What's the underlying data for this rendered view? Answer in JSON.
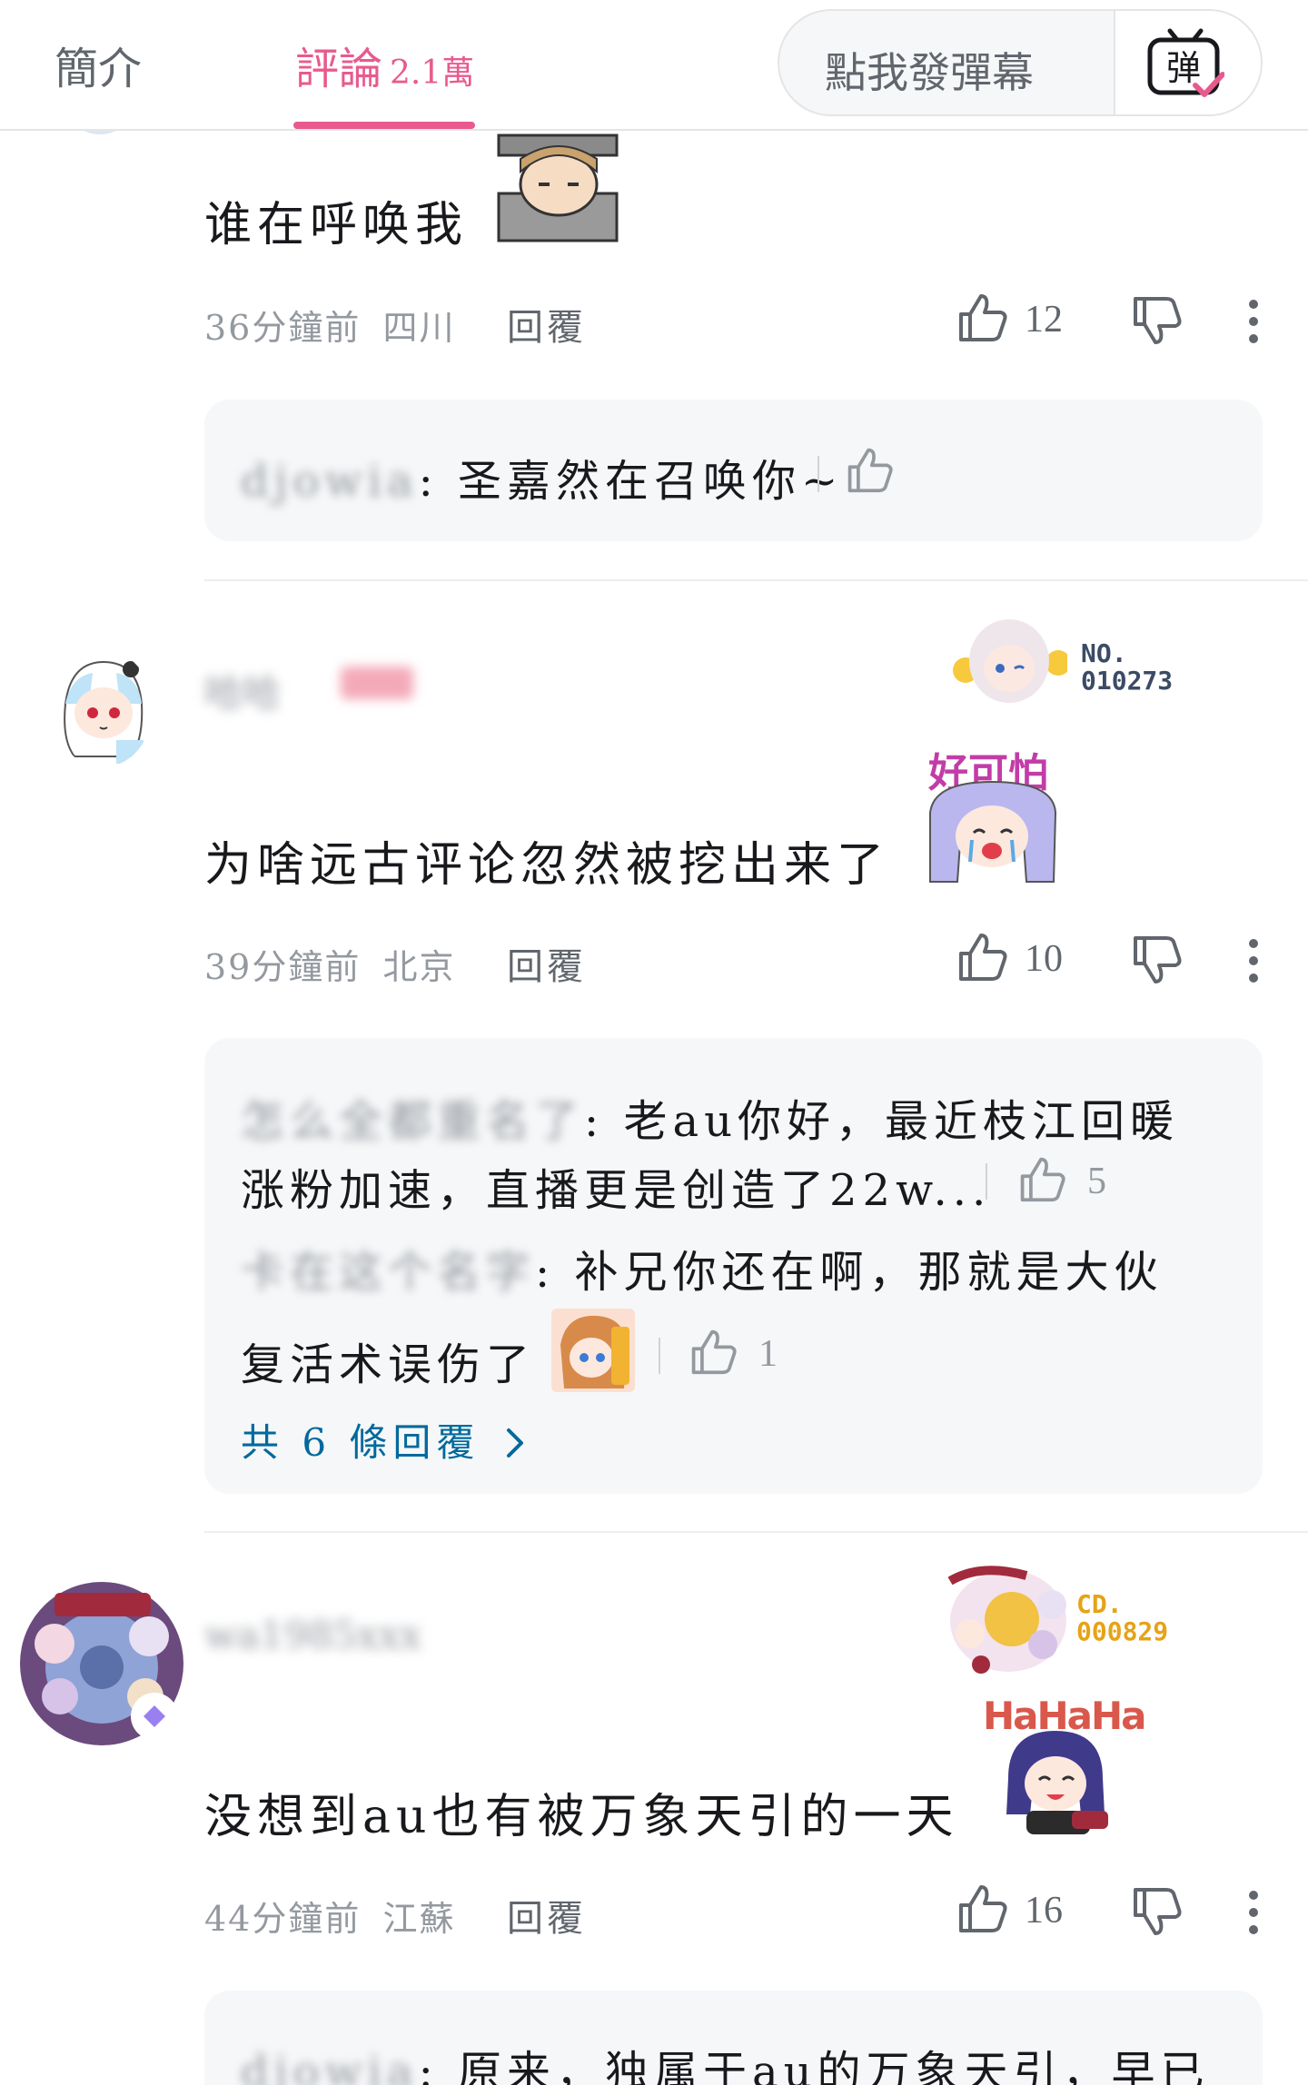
{
  "header": {
    "tab_intro": "簡介",
    "tab_comments": "評論",
    "comment_count": "2.1萬",
    "danmaku_placeholder": "點我發彈幕",
    "danmaku_button": "弹"
  },
  "comments": [
    {
      "text": "谁在呼唤我",
      "time": "36分鐘前",
      "location": "四川",
      "reply": "回覆",
      "likes": "12",
      "sub_replies": [
        {
          "user": "djowia",
          "text": ": 圣嘉然在召唤你~",
          "likes": ""
        }
      ]
    },
    {
      "username": "哈哈",
      "badge_no": "NO.\n010273",
      "sticker_text": "好可怕",
      "text": "为啥远古评论忽然被挖出来了",
      "time": "39分鐘前",
      "location": "北京",
      "reply": "回覆",
      "likes": "10",
      "sub_replies": [
        {
          "user": "怎么全都重名了",
          "text": ": 老au你好，最近枝江回暖",
          "text2": "涨粉加速，直播更是创造了22w...",
          "likes": "5"
        },
        {
          "user": "卡在这个名字",
          "text": ": 补兄你还在啊，那就是大伙",
          "text2": "复活术误伤了",
          "likes": "1"
        }
      ],
      "more_replies": "共 6 條回覆"
    },
    {
      "username": "wa1985xxx",
      "badge_no": "CD.\n000829",
      "sticker_text": "HaHaHa",
      "text": "没想到au也有被万象天引的一天",
      "time": "44分鐘前",
      "location": "江蘇",
      "reply": "回覆",
      "likes": "16",
      "sub_replies": [
        {
          "user": "djowia",
          "text": ": 原来，独属于au的万象天引，早已"
        }
      ]
    }
  ],
  "colors": {
    "accent": "#e85a8e",
    "link": "#00699d",
    "muted": "#9499a0"
  },
  "icons": [
    "like-icon",
    "dislike-icon",
    "more-icon",
    "chevron-right-icon",
    "danmaku-tv-icon"
  ]
}
